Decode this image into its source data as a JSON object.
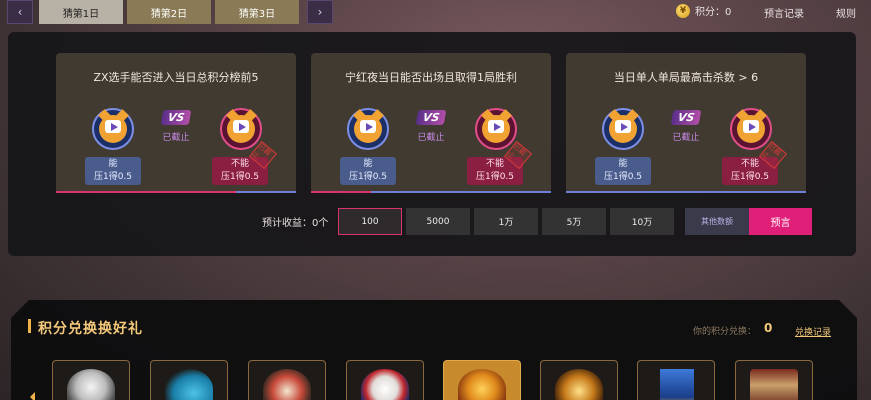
{
  "tabs": {
    "prev_icon": "chevron-left-icon",
    "next_icon": "chevron-right-icon",
    "items": [
      {
        "label": "猜第1日",
        "active": true
      },
      {
        "label": "猜第2日",
        "active": false
      },
      {
        "label": "猜第3日",
        "active": false
      }
    ]
  },
  "header": {
    "coin_icon": "coin-icon",
    "points_label": "积分：0",
    "history_link": "预言记录",
    "rules_link": "规则"
  },
  "cards": [
    {
      "title": "ZX选手能否进入当日总积分榜前5",
      "vs": "VS",
      "status": "已截止",
      "yes_label": "能",
      "yes_odds": "压1得0.5",
      "no_label": "不能",
      "no_odds": "压1得0.5",
      "stamp": "已截止",
      "progress": 0.75
    },
    {
      "title": "宁红夜当日能否出场且取得1局胜利",
      "vs": "VS",
      "status": "已截止",
      "yes_label": "能",
      "yes_odds": "压1得0.5",
      "no_label": "不能",
      "no_odds": "压1得0.5",
      "stamp": "已截止",
      "progress": 0.25
    },
    {
      "title": "当日单人单局最高击杀数 > 6",
      "vs": "VS",
      "status": "已截止",
      "yes_label": "能",
      "yes_odds": "压1得0.5",
      "no_label": "不能",
      "no_odds": "压1得0.5",
      "stamp": "已截止",
      "progress": 0.0
    }
  ],
  "bet": {
    "label": "预计收益：0个",
    "amounts": [
      "100",
      "5000",
      "1万",
      "5万",
      "10万"
    ],
    "selected": "100",
    "other_label": "其他数额",
    "predict_label": "预言"
  },
  "exchange": {
    "title": "积分兑换换好礼",
    "points_label": "你的积分兑换：",
    "points_value": "0",
    "record_link": "兑换记录",
    "items": [
      {
        "icon": "coins-icon"
      },
      {
        "icon": "fish-icon"
      },
      {
        "icon": "creature-icon"
      },
      {
        "icon": "cartoon-face-icon"
      },
      {
        "icon": "dragon-emblem-icon"
      },
      {
        "icon": "golden-crest-icon"
      },
      {
        "icon": "banner-icon"
      },
      {
        "icon": "chest-icon"
      }
    ]
  },
  "colors": {
    "accent_pink": "#e01f78",
    "accent_gold": "#f4c87a",
    "blue_button": "#4a5c8c",
    "red_button": "#8a1f42"
  }
}
